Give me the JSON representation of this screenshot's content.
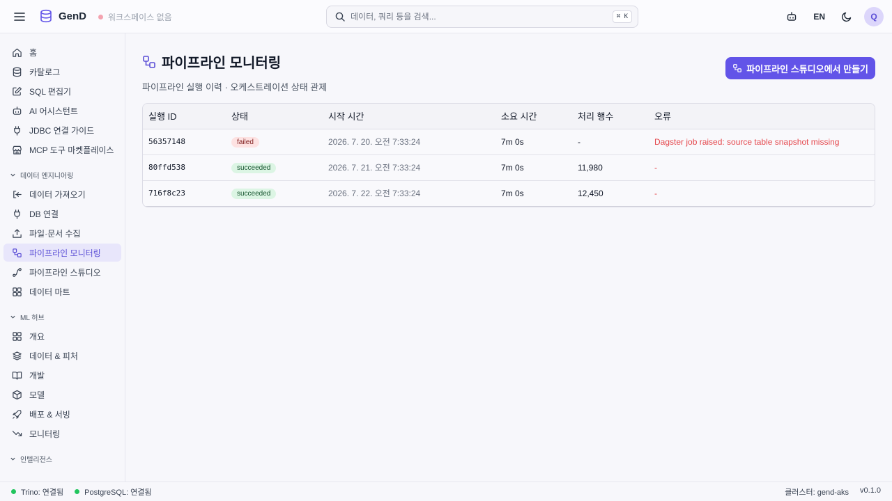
{
  "header": {
    "app_name": "GenD",
    "workspace": "워크스페이스 없음",
    "search_placeholder": "데이터, 쿼리 등을 검색...",
    "search_shortcut": "⌘ K",
    "language": "EN",
    "avatar_initial": "Q"
  },
  "sidebar": {
    "top_items": [
      {
        "label": "홈",
        "icon": "home-icon"
      },
      {
        "label": "카탈로그",
        "icon": "database-icon"
      },
      {
        "label": "SQL 편집기",
        "icon": "edit-icon"
      },
      {
        "label": "AI 어시스턴트",
        "icon": "bot-icon"
      },
      {
        "label": "JDBC 연결 가이드",
        "icon": "plug-icon"
      },
      {
        "label": "MCP 도구 마켓플레이스",
        "icon": "store-icon"
      }
    ],
    "data_eng": {
      "title": "데이터 엔지니어링",
      "items": [
        {
          "label": "데이터 가져오기",
          "icon": "import-icon"
        },
        {
          "label": "DB 연결",
          "icon": "plug-icon"
        },
        {
          "label": "파일·문서 수집",
          "icon": "upload-icon"
        },
        {
          "label": "파이프라인 모니터링",
          "icon": "workflow-icon",
          "active": true
        },
        {
          "label": "파이프라인 스튜디오",
          "icon": "spline-icon"
        },
        {
          "label": "데이터 마트",
          "icon": "grid-icon"
        }
      ]
    },
    "ml_hub": {
      "title": "ML 허브",
      "items": [
        {
          "label": "개요",
          "icon": "grid-icon"
        },
        {
          "label": "데이터 & 피처",
          "icon": "layers-icon"
        },
        {
          "label": "개발",
          "icon": "book-icon"
        },
        {
          "label": "모델",
          "icon": "box-icon"
        },
        {
          "label": "배포 & 서빙",
          "icon": "rocket-icon"
        },
        {
          "label": "모니터링",
          "icon": "trend-down-icon"
        }
      ]
    },
    "cut_section": "인텔리전스"
  },
  "page": {
    "title": "파이프라인 모니터링",
    "subtitle": "파이프라인 실행 이력 · 오케스트레이션 상태 관제",
    "create_button": "파이프라인 스튜디오에서 만들기"
  },
  "table": {
    "columns": [
      "실행 ID",
      "상태",
      "시작 시간",
      "소요 시간",
      "처리 행수",
      "오류"
    ],
    "rows": [
      {
        "id": "56357148",
        "status": "failed",
        "start": "2026. 7. 20. 오전 7:33:24",
        "duration": "7m 0s",
        "rows": "-",
        "error": "Dagster job raised: source table snapshot missing"
      },
      {
        "id": "80ffd538",
        "status": "succeeded",
        "start": "2026. 7. 21. 오전 7:33:24",
        "duration": "7m 0s",
        "rows": "11,980",
        "error": "-"
      },
      {
        "id": "716f8c23",
        "status": "succeeded",
        "start": "2026. 7. 22. 오전 7:33:24",
        "duration": "7m 0s",
        "rows": "12,450",
        "error": "-"
      }
    ]
  },
  "statusbar": {
    "trino": "Trino: 연결됨",
    "postgres": "PostgreSQL: 연결됨",
    "cluster": "클러스터: gend-aks",
    "version": "v0.1.0"
  },
  "colors": {
    "accent": "#6254e8",
    "error": "#e5484d",
    "ok": "#22c55e"
  }
}
